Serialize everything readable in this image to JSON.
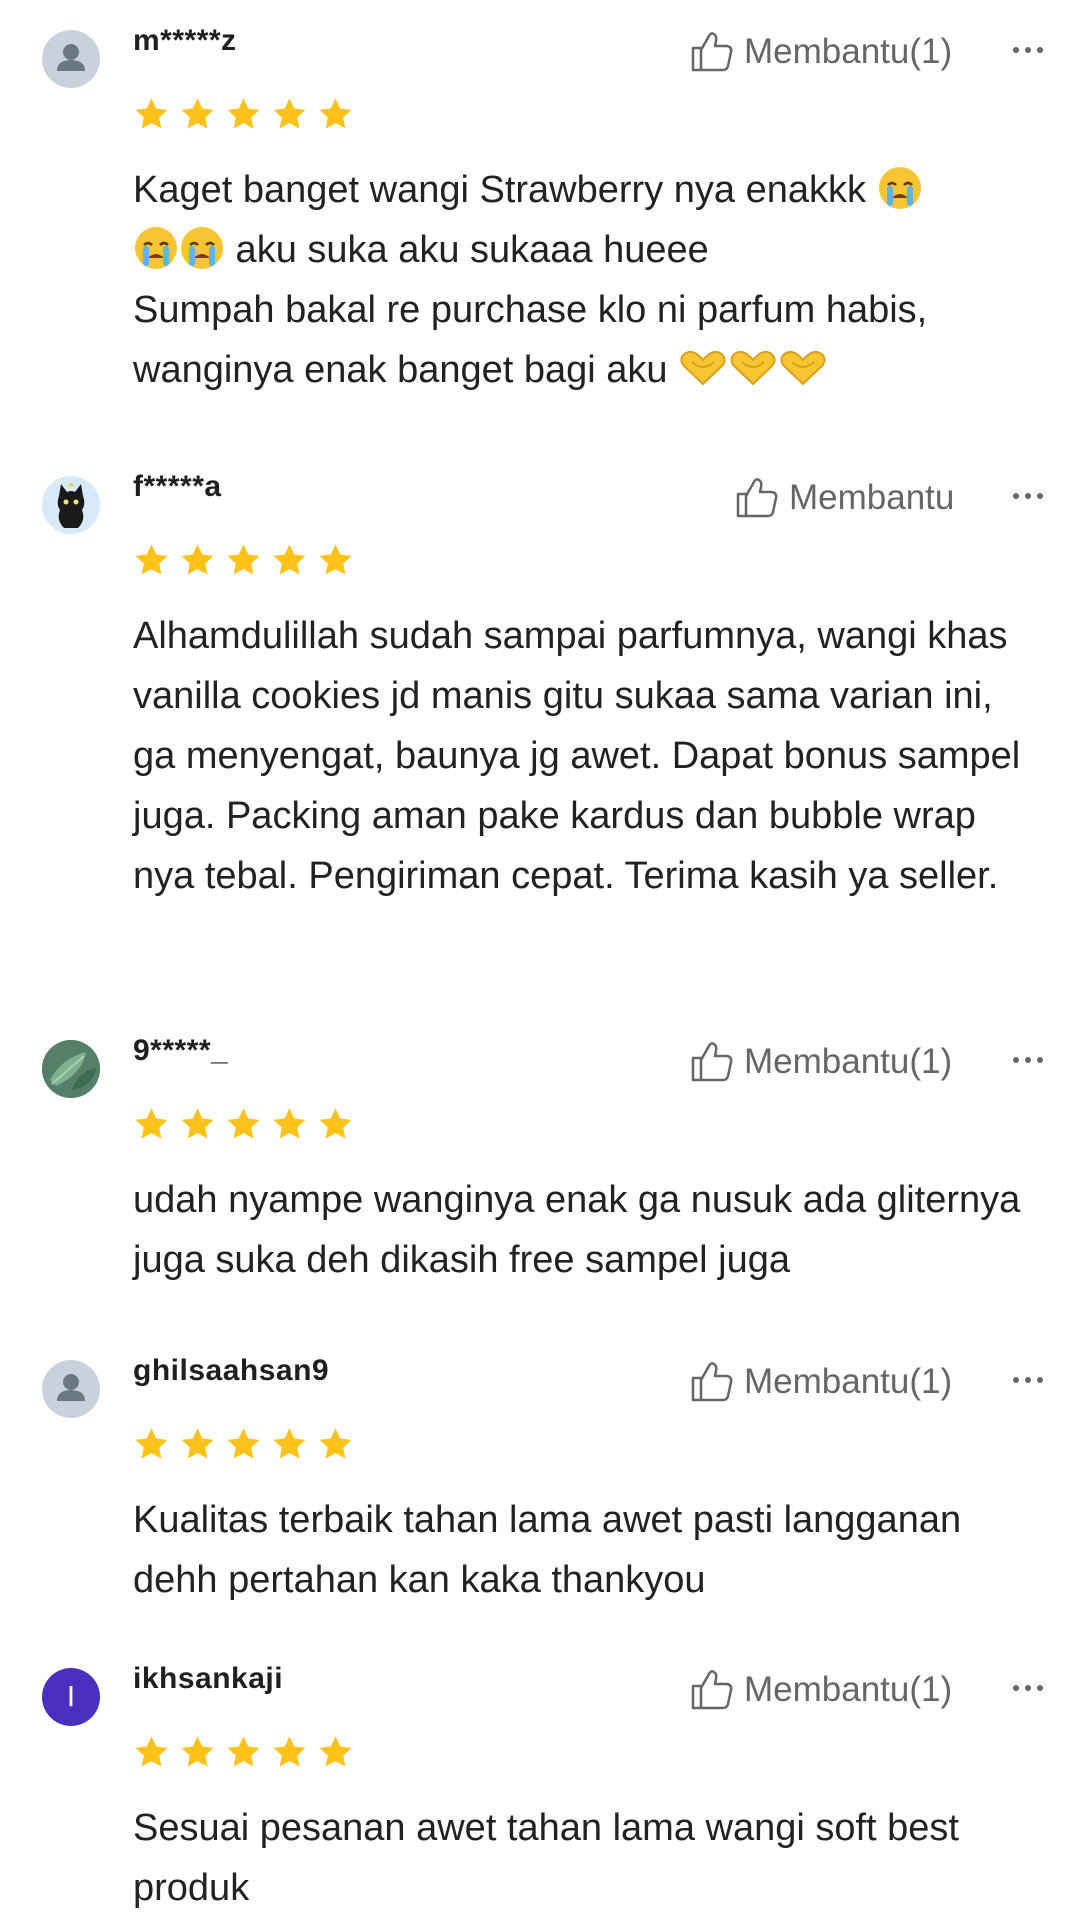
{
  "reviews": [
    {
      "username": "m*****z",
      "avatar": "default-user-icon",
      "rating": 5,
      "helpful_label": "Membantu(1)",
      "text_1": "Kaget banget wangi Strawberry nya enakkk ",
      "text_2": " aku suka aku sukaaa hueee",
      "text_3": "Sumpah bakal re purchase klo ni parfum habis,",
      "text_4": "wanginya enak banget bagi aku "
    },
    {
      "username": "f*****a",
      "avatar": "black-cat-avatar",
      "rating": 5,
      "helpful_label": "Membantu",
      "text": "Alhamdulillah sudah sampai parfumnya, wangi khas vanilla cookies jd manis gitu sukaa sama varian ini, ga menyengat, baunya jg awet. Dapat bonus sampel juga. Packing aman pake kardus dan bubble wrap nya tebal. Pengiriman cepat. Terima kasih ya seller."
    },
    {
      "username": "9*****_",
      "avatar": "green-leaf-avatar",
      "rating": 5,
      "helpful_label": "Membantu(1)",
      "text": "udah nyampe wanginya enak ga nusuk ada gliternya juga suka deh dikasih free sampel juga"
    },
    {
      "username": "ghilsaahsan9",
      "avatar": "default-user-icon",
      "rating": 5,
      "helpful_label": "Membantu(1)",
      "text": "Kualitas terbaik tahan lama awet pasti langganan dehh pertahan kan kaka thankyou"
    },
    {
      "username": "ikhsankaji",
      "avatar": "letter-avatar",
      "avatar_letter": "I",
      "rating": 5,
      "helpful_label": "Membantu(1)",
      "text": "Sesuai pesanan awet tahan lama wangi soft best produk"
    }
  ],
  "colors": {
    "star": "#FFC21A",
    "helpful_text": "#666666",
    "letter_avatar_bg": "#4B2FC0"
  }
}
